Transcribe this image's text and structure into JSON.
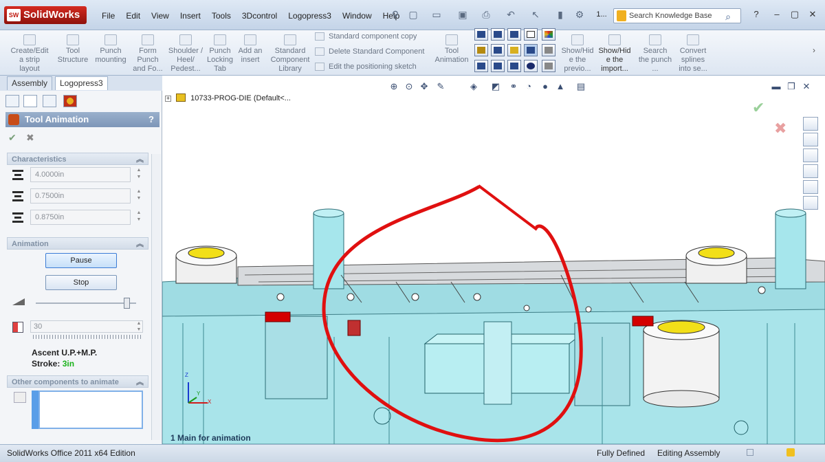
{
  "app": {
    "logo": "SolidWorks",
    "logo_mark": "SW"
  },
  "menu": [
    "File",
    "Edit",
    "View",
    "Insert",
    "Tools",
    "3Dcontrol",
    "Logopress3",
    "Window",
    "Help"
  ],
  "title_fragment": "1...",
  "search": {
    "placeholder": "Search Knowledge Base"
  },
  "ribbon": {
    "buttons": [
      {
        "label": "Create/Edit a strip layout"
      },
      {
        "label": "Tool Structure"
      },
      {
        "label": "Punch mounting"
      },
      {
        "label": "Form Punch and Fo..."
      },
      {
        "label": "Shoulder / Heel/ Pedest..."
      },
      {
        "label": "Punch Locking Tab"
      },
      {
        "label": "Add an insert"
      },
      {
        "label": "Standard Component Library"
      },
      {
        "label": "Tool Animation"
      },
      {
        "label": "Show/Hid e the previo..."
      },
      {
        "label": "Show/Hid e the import..."
      },
      {
        "label": "Search the punch ..."
      },
      {
        "label": "Convert splines into se..."
      }
    ],
    "small": [
      "Standard component copy",
      "Delete Standard Component",
      "Edit the positioning sketch"
    ]
  },
  "tabs": [
    "Assembly",
    "Logopress3"
  ],
  "panel": {
    "title": "Tool Animation",
    "help": "?",
    "characteristics": {
      "header": "Characteristics",
      "values": [
        "4.0000in",
        "0.7500in",
        "0.8750in"
      ]
    },
    "animation": {
      "header": "Animation",
      "pause": "Pause",
      "stop": "Stop",
      "speed": "30",
      "ascent": "Ascent U.P.+M.P.",
      "stroke_label": "Stroke:",
      "stroke_value": "3in"
    },
    "other": {
      "header": "Other components to animate"
    }
  },
  "viewport": {
    "tree_item": "10733-PROG-DIE",
    "tree_config": "(Default<...",
    "footer": "1 Main for animation",
    "axes": {
      "x": "X",
      "y": "Y",
      "z": "Z"
    }
  },
  "status": {
    "edition": "SolidWorks Office 2011 x64 Edition",
    "state": "Fully Defined",
    "mode": "Editing Assembly"
  },
  "colors": {
    "accent_red": "#d40000",
    "die_cyan": "#9fe2e8",
    "pad_yellow": "#f2df18"
  }
}
